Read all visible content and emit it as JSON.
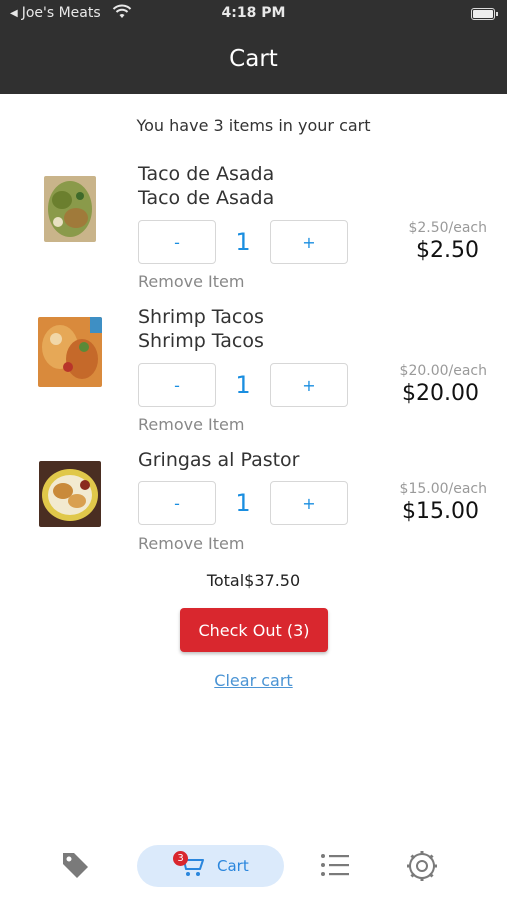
{
  "status_bar": {
    "back_label": "Joe's Meats",
    "time": "4:18 PM"
  },
  "nav": {
    "title": "Cart"
  },
  "summary": "You have 3 items in your cart",
  "items": [
    {
      "name_line1": "Taco de Asada",
      "name_line2": "Taco de Asada",
      "decrement": "-",
      "quantity": "1",
      "increment": "+",
      "remove": "Remove Item",
      "unit_price": "$2.50/each",
      "line_total": "$2.50"
    },
    {
      "name_line1": "Shrimp Tacos",
      "name_line2": "Shrimp Tacos",
      "decrement": "-",
      "quantity": "1",
      "increment": "+",
      "remove": "Remove Item",
      "unit_price": "$20.00/each",
      "line_total": "$20.00"
    },
    {
      "name_line1": "Gringas al Pastor",
      "decrement": "-",
      "quantity": "1",
      "increment": "+",
      "remove": "Remove Item",
      "unit_price": "$15.00/each",
      "line_total": "$15.00"
    }
  ],
  "total": "Total$37.50",
  "checkout": "Check Out (3)",
  "clear": "Clear cart",
  "tabs": {
    "deals_icon": "tag-icon",
    "cart_label": "Cart",
    "cart_badge": "3",
    "orders_icon": "list-icon",
    "settings_icon": "gear-icon"
  },
  "colors": {
    "header": "#303030",
    "accent": "#1a8ee0",
    "checkout": "#d9272e",
    "pill": "#dbeafb"
  }
}
